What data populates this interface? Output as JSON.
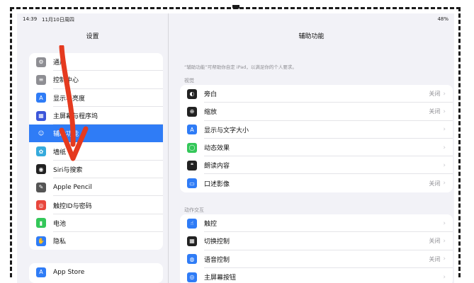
{
  "status": {
    "time": "14:39",
    "date": "11月10日周四",
    "battery": "48%"
  },
  "sidebar": {
    "title": "设置",
    "items": [
      {
        "label": "通用",
        "icon": "gear-icon",
        "color": "#8e8e93"
      },
      {
        "label": "控制中心",
        "icon": "switches-icon",
        "color": "#8e8e93"
      },
      {
        "label": "显示与亮度",
        "icon": "text-size-icon",
        "color": "#2f7cf6"
      },
      {
        "label": "主屏幕与程序坞",
        "icon": "grid-icon",
        "color": "#3b55d9"
      },
      {
        "label": "辅助功能",
        "icon": "accessibility-icon",
        "color": "#2f7cf6",
        "selected": true
      },
      {
        "label": "墙纸",
        "icon": "flower-icon",
        "color": "#35aadc"
      },
      {
        "label": "Siri与搜索",
        "icon": "siri-icon",
        "color": "#222222"
      },
      {
        "label": "Apple Pencil",
        "icon": "pencil-icon",
        "color": "#555555"
      },
      {
        "label": "触控ID与密码",
        "icon": "fingerprint-icon",
        "color": "#e8463c"
      },
      {
        "label": "电池",
        "icon": "battery-icon",
        "color": "#34c759"
      },
      {
        "label": "隐私",
        "icon": "hand-icon",
        "color": "#2f7cf6"
      }
    ],
    "items2": [
      {
        "label": "App Store",
        "icon": "appstore-icon",
        "color": "#2f7cf6"
      }
    ]
  },
  "detail": {
    "title": "辅助功能",
    "description": "“辅助功能”可帮助你自定 iPad，以满足你的个人要求。",
    "section_vision": "视觉",
    "vision_items": [
      {
        "label": "旁白",
        "value": "关闭",
        "icon": "voiceover-icon",
        "color": "#222222"
      },
      {
        "label": "缩放",
        "value": "关闭",
        "icon": "zoom-icon",
        "color": "#222222"
      },
      {
        "label": "显示与文字大小",
        "value": "",
        "icon": "text-size-icon",
        "color": "#2f7cf6"
      },
      {
        "label": "动态效果",
        "value": "",
        "icon": "motion-icon",
        "color": "#34c759"
      },
      {
        "label": "朗读内容",
        "value": "",
        "icon": "speech-icon",
        "color": "#222222"
      },
      {
        "label": "口述影像",
        "value": "关闭",
        "icon": "audio-description-icon",
        "color": "#2f7cf6"
      }
    ],
    "section_interaction": "动作交互",
    "interaction_items": [
      {
        "label": "触控",
        "value": "",
        "icon": "touch-icon",
        "color": "#2f7cf6"
      },
      {
        "label": "切换控制",
        "value": "关闭",
        "icon": "switch-control-icon",
        "color": "#222222"
      },
      {
        "label": "语音控制",
        "value": "关闭",
        "icon": "voice-control-icon",
        "color": "#2f7cf6"
      },
      {
        "label": "主屏幕按钮",
        "value": "",
        "icon": "home-button-icon",
        "color": "#2f7cf6"
      }
    ]
  }
}
